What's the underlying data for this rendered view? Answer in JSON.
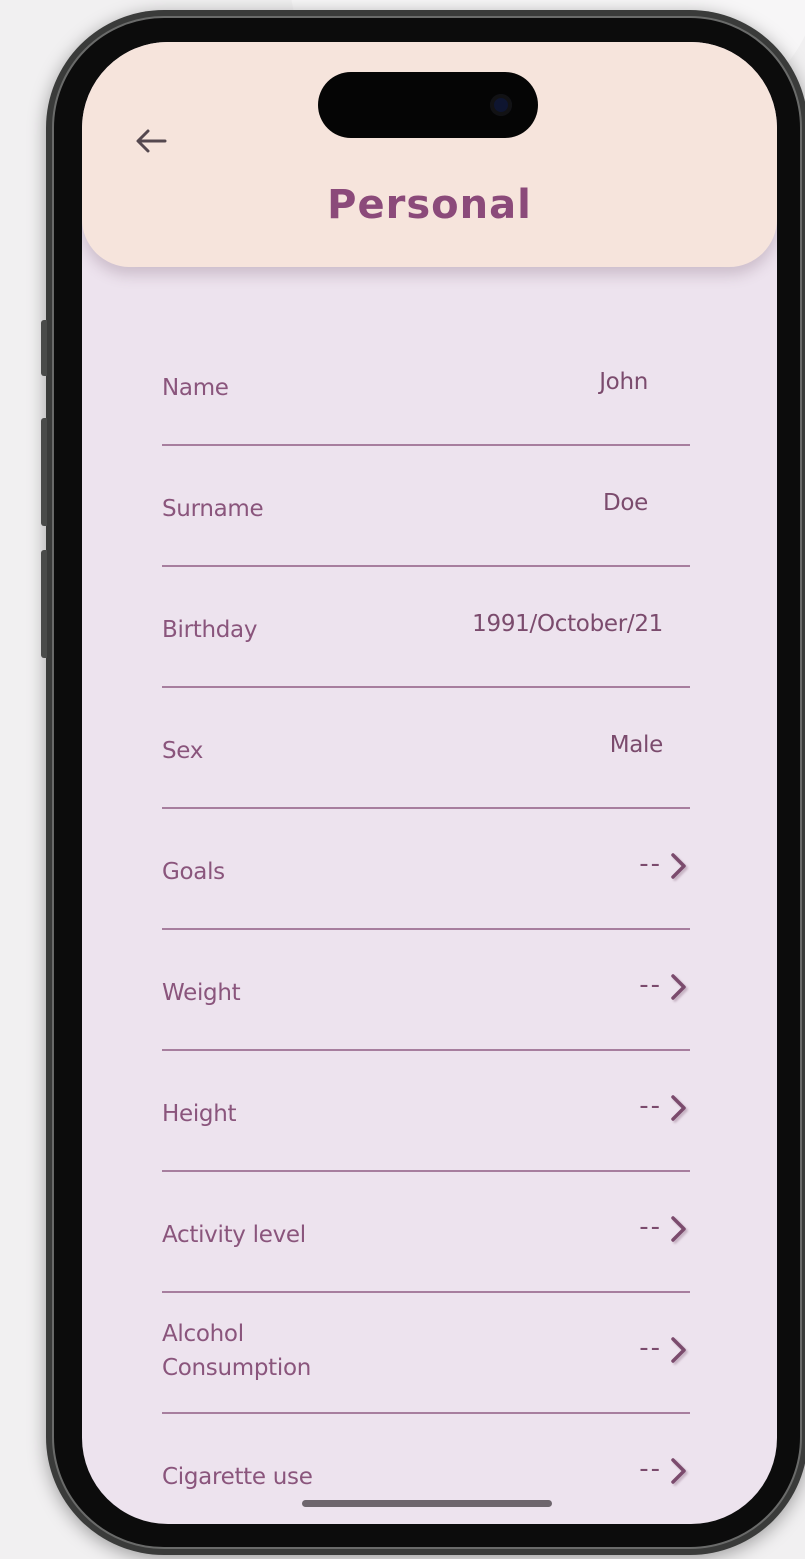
{
  "header": {
    "title": "Personal",
    "back_icon": "arrow-left-icon"
  },
  "colors": {
    "header_bg": "#f6e4dc",
    "screen_bg": "#ede3ee",
    "accent": "#8b4a7a",
    "divider": "#a77e9e"
  },
  "fields": [
    {
      "label": "Name",
      "value": "John"
    },
    {
      "label": "Surname",
      "value": "Doe"
    },
    {
      "label": "Birthday",
      "value": "1991/October/21"
    },
    {
      "label": "Sex",
      "value": "Male"
    },
    {
      "label": "Goals",
      "value": "--",
      "icon": "chevron-right-icon"
    },
    {
      "label": "Weight",
      "value": "--",
      "icon": "chevron-right-icon"
    },
    {
      "label": "Height",
      "value": "--",
      "icon": "chevron-right-icon"
    },
    {
      "label": "Activity level",
      "value": "--",
      "icon": "chevron-right-icon"
    },
    {
      "label_line1": "Alcohol",
      "label_line2": "Consumption",
      "value": "--",
      "icon": "chevron-right-icon"
    },
    {
      "label": "Cigarette use",
      "value": "--",
      "icon": "chevron-right-icon"
    }
  ]
}
